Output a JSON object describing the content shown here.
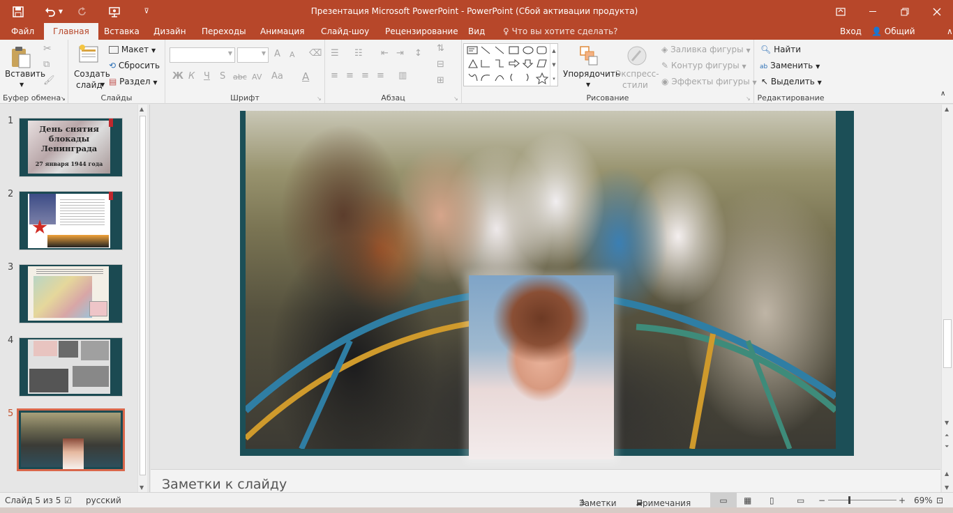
{
  "window": {
    "title": "Презентация Microsoft PowerPoint - PowerPoint (Сбой активации продукта)"
  },
  "quick_access": {
    "save_icon": "save-icon",
    "undo_icon": "undo-icon",
    "redo_icon": "redo-icon",
    "present_icon": "present-icon",
    "customize_icon": "customize-icon"
  },
  "tabs": [
    "Файл",
    "Главная",
    "Вставка",
    "Дизайн",
    "Переходы",
    "Анимация",
    "Слайд-шоу",
    "Рецензирование",
    "Вид"
  ],
  "tell_me": "Что вы хотите сделать?",
  "signin": "Вход",
  "share": "Общий доступ",
  "ribbon": {
    "clipboard": {
      "paste": "Вставить",
      "label": "Буфер обмена"
    },
    "slides": {
      "new_slide": "Создать",
      "new_slide2": "слайд",
      "layout": "Макет",
      "reset": "Сбросить",
      "section": "Раздел",
      "label": "Слайды"
    },
    "font": {
      "bold": "Ж",
      "italic": "К",
      "underline": "Ч",
      "shadow": "S",
      "strike": "abc",
      "spacing": "AV",
      "case": "Aa",
      "color": "A",
      "grow": "A",
      "shrink": "A",
      "label": "Шрифт"
    },
    "paragraph": {
      "label": "Абзац"
    },
    "drawing": {
      "arrange": "Упорядочить",
      "styles": "Экспресс-",
      "styles2": "стили",
      "fill": "Заливка фигуры",
      "outline": "Контур фигуры",
      "effects": "Эффекты фигуры",
      "label": "Рисование"
    },
    "editing": {
      "find": "Найти",
      "replace": "Заменить",
      "select": "Выделить",
      "label": "Редактирование"
    }
  },
  "slides": [
    {
      "num": "1",
      "title": "День снятия блокады Ленинграда",
      "subtitle": "27 января 1944 года"
    },
    {
      "num": "2"
    },
    {
      "num": "3"
    },
    {
      "num": "4"
    },
    {
      "num": "5"
    }
  ],
  "notes_placeholder": "Заметки к слайду",
  "status": {
    "slide_of": "Слайд 5 из 5",
    "language": "русский",
    "notes_btn": "Заметки",
    "comments_btn": "Примечания",
    "zoom": "69%"
  },
  "colors": {
    "accent": "#b7472a",
    "slide_bg": "#1c4f57",
    "selected_border": "#d9674b"
  }
}
